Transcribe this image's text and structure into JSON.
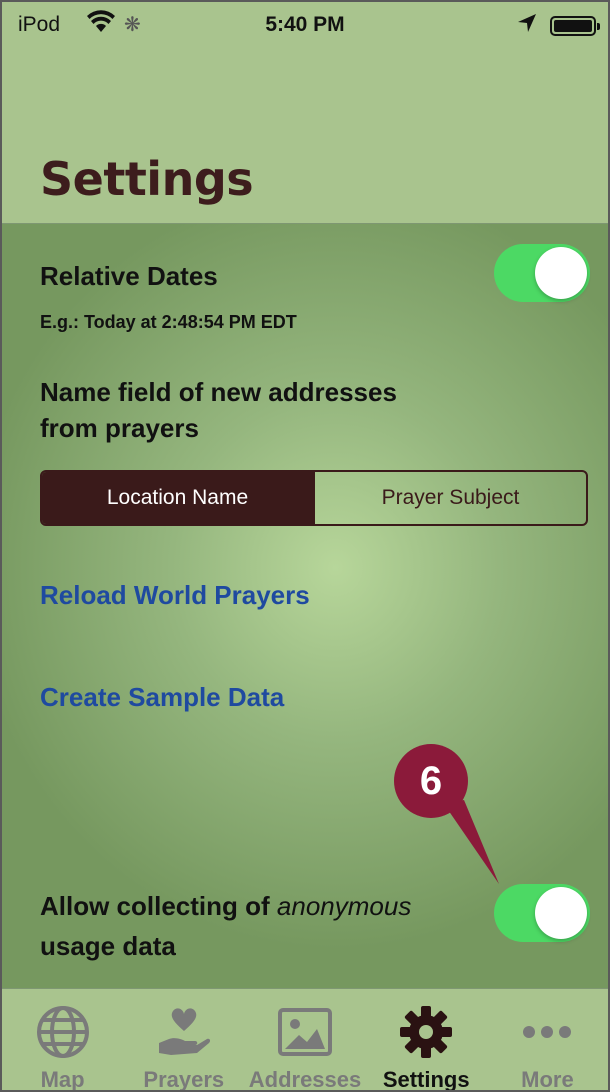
{
  "status_bar": {
    "carrier": "iPod",
    "time": "5:40 PM"
  },
  "header": {
    "title": "Settings"
  },
  "settings": {
    "relative_dates": {
      "label": "Relative Dates",
      "example": "E.g.: Today at 2:48:54 PM EDT",
      "enabled": true
    },
    "name_field": {
      "label_line1": "Name field of new addresses",
      "label_line2": "from prayers",
      "options": [
        "Location Name",
        "Prayer Subject"
      ],
      "selected": "Location Name"
    },
    "reload_link": "Reload World Prayers",
    "sample_link": "Create Sample Data",
    "analytics": {
      "label_prefix": "Allow collecting of ",
      "label_emphasis": "anonymous",
      "label_line2": "usage data",
      "enabled": true
    }
  },
  "callout": {
    "number": "6"
  },
  "tabs": [
    {
      "label": "Map",
      "icon": "globe-icon",
      "active": false
    },
    {
      "label": "Prayers",
      "icon": "heart-hand-icon",
      "active": false
    },
    {
      "label": "Addresses",
      "icon": "image-icon",
      "active": false
    },
    {
      "label": "Settings",
      "icon": "gear-icon",
      "active": true
    },
    {
      "label": "More",
      "icon": "ellipsis-icon",
      "active": false
    }
  ],
  "colors": {
    "accent_green": "#4cd964",
    "title_brown": "#3d1d1d",
    "link_blue": "#1f4aa0",
    "callout": "#8b1a3a",
    "background": "#a9c48e"
  }
}
